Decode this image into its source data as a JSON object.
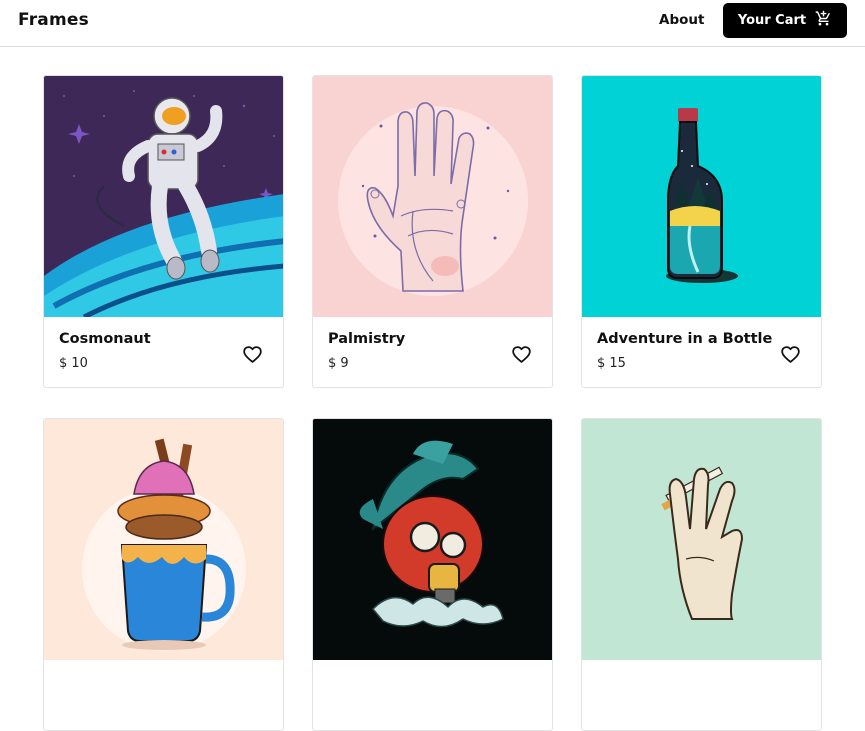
{
  "header": {
    "brand": "Frames",
    "nav": {
      "about_label": "About"
    },
    "cart_label": "Your Cart",
    "cart_icon": "shopping-cart-icon"
  },
  "products": [
    {
      "title": "Cosmonaut",
      "price": "$ 10",
      "favorite_icon": "heart-outline-icon",
      "bg_color": "#3d2858"
    },
    {
      "title": "Palmistry",
      "price": "$ 9",
      "favorite_icon": "heart-outline-icon",
      "bg_color": "#f9d3d2"
    },
    {
      "title": "Adventure in a Bottle",
      "price": "$ 15",
      "favorite_icon": "heart-outline-icon",
      "bg_color": "#00d2d6"
    },
    {
      "title": "",
      "price": "",
      "favorite_icon": "heart-outline-icon",
      "bg_color": "#fde8da"
    },
    {
      "title": "",
      "price": "",
      "favorite_icon": "heart-outline-icon",
      "bg_color": "#050a0a"
    },
    {
      "title": "",
      "price": "",
      "favorite_icon": "heart-outline-icon",
      "bg_color": "#c2e6d4"
    }
  ]
}
